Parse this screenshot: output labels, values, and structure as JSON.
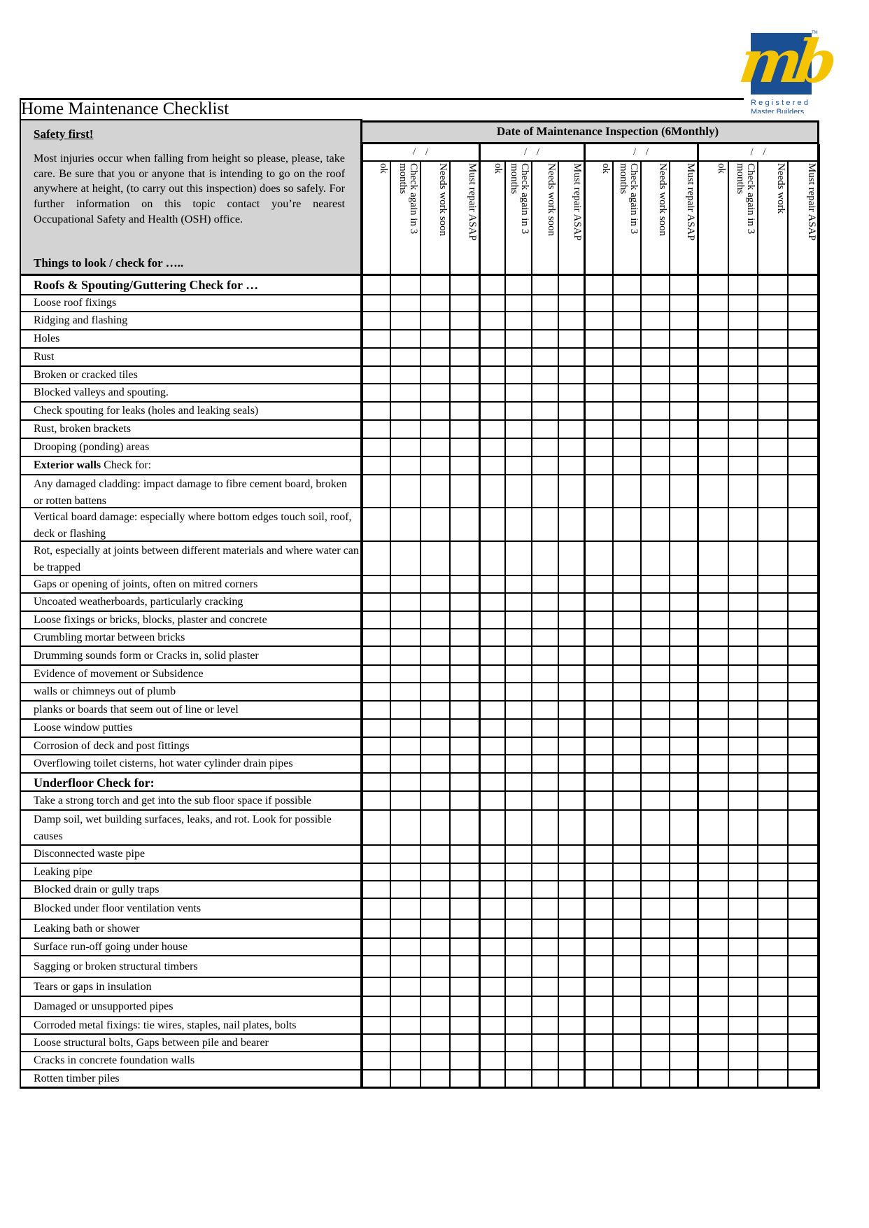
{
  "logo": {
    "monogram": "mb",
    "trademark": "TM",
    "line1": "Registered",
    "line2": "Master Builders",
    "colors": {
      "blue": "#1b4f93",
      "yellow": "#f5c400"
    }
  },
  "document": {
    "title": "Home Maintenance Checklist"
  },
  "safety": {
    "title": "Safety first!",
    "body": "Most injuries occur when falling from height so please, please, take care. Be sure that you or anyone that is intending to go on the roof anywhere at height, (to carry out this inspection) does so safely. For further information on this topic contact you’re nearest Occupational Safety and Health (OSH) office.",
    "things_label": "Things to look / check  for ….."
  },
  "inspection": {
    "header": "Date of Maintenance Inspection (6Monthly)",
    "groups": [
      {
        "date": "/    /",
        "columns": [
          "ok",
          "Check again in 3\nmonths",
          "Needs work soon",
          "Must repair ASAP"
        ]
      },
      {
        "date": "/    /",
        "columns": [
          "ok",
          "Check again in 3\nmonths",
          "Needs work soon",
          "Must repair ASAP"
        ]
      },
      {
        "date": "/    /",
        "columns": [
          "ok",
          "Check again in 3\nmonths",
          "Needs work soon",
          "Must repair ASAP"
        ]
      },
      {
        "date": "/    /",
        "columns": [
          "ok",
          "Check again in 3\nmonths",
          "Needs work",
          "Must repair ASAP"
        ]
      }
    ]
  },
  "rows": [
    {
      "type": "section",
      "label": "Roofs & Spouting/Guttering Check for …"
    },
    {
      "type": "item",
      "label": "Loose roof fixings"
    },
    {
      "type": "item",
      "label": "Ridging and flashing"
    },
    {
      "type": "item",
      "label": "Holes"
    },
    {
      "type": "item",
      "label": "Rust"
    },
    {
      "type": "item",
      "label": "Broken or cracked tiles"
    },
    {
      "type": "item",
      "label": "Blocked valleys and spouting."
    },
    {
      "type": "item",
      "label": "Check spouting for leaks (holes and leaking seals)"
    },
    {
      "type": "item",
      "label": "Rust, broken brackets"
    },
    {
      "type": "item",
      "label": "Drooping (ponding) areas"
    },
    {
      "type": "section-inline",
      "bold": "Exterior walls",
      "label": " Check for:"
    },
    {
      "type": "item",
      "label": "Any damaged cladding: impact damage to fibre cement board, broken or rotten battens",
      "wrap": true
    },
    {
      "type": "item",
      "label": "Vertical board damage: especially where bottom edges touch soil, roof, deck or flashing",
      "wrap": true
    },
    {
      "type": "item",
      "label": "Rot, especially at joints between different materials and where water can be trapped",
      "wrap": true
    },
    {
      "type": "item",
      "label": "Gaps or opening of joints, often on mitred corners"
    },
    {
      "type": "item",
      "label": "Uncoated weatherboards, particularly cracking"
    },
    {
      "type": "item",
      "label": "Loose fixings or bricks, blocks, plaster and concrete"
    },
    {
      "type": "item",
      "label": "Crumbling mortar between bricks"
    },
    {
      "type": "item",
      "label": "Drumming sounds form or Cracks in, solid plaster"
    },
    {
      "type": "item",
      "label": "Evidence of movement or Subsidence"
    },
    {
      "type": "item",
      "label": "walls or chimneys out of plumb"
    },
    {
      "type": "item",
      "label": "planks or boards that seem out of line or level"
    },
    {
      "type": "item",
      "label": "Loose window putties"
    },
    {
      "type": "item",
      "label": "Corrosion of deck and post fittings"
    },
    {
      "type": "item",
      "label": "Overflowing toilet cisterns, hot water cylinder drain pipes"
    },
    {
      "type": "section",
      "label": "Underfloor Check for:"
    },
    {
      "type": "item",
      "label": "Take a strong torch and get into the sub floor space if possible"
    },
    {
      "type": "item",
      "label": "Damp soil, wet building surfaces, leaks, and rot. Look for possible causes",
      "wrap": true
    },
    {
      "type": "item",
      "label": "Disconnected waste pipe"
    },
    {
      "type": "item",
      "label": "Leaking pipe"
    },
    {
      "type": "item",
      "label": "Blocked drain or gully traps"
    },
    {
      "type": "item",
      "label": "Blocked under floor ventilation vents"
    },
    {
      "type": "item",
      "label": "Leaking bath or shower"
    },
    {
      "type": "item",
      "label": "Surface run-off going under house"
    },
    {
      "type": "item",
      "label": "Sagging or broken structural timbers"
    },
    {
      "type": "item",
      "label": "Tears or gaps in insulation"
    },
    {
      "type": "item",
      "label": "Damaged or unsupported pipes"
    },
    {
      "type": "item",
      "label": "Corroded metal fixings: tie wires, staples, nail plates, bolts"
    },
    {
      "type": "item",
      "label": "Loose structural bolts, Gaps between pile and bearer"
    },
    {
      "type": "item",
      "label": "Cracks in concrete foundation walls"
    },
    {
      "type": "item",
      "label": "Rotten timber piles"
    }
  ]
}
